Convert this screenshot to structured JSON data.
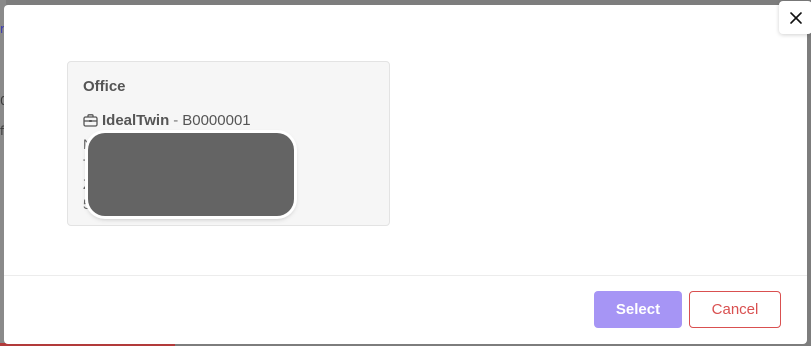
{
  "backdrop": {
    "peek_chars": [
      "r",
      "0",
      "f"
    ]
  },
  "modal": {
    "close_icon": "close-icon",
    "card": {
      "title": "Office",
      "company_icon": "briefcase-icon",
      "company_name": "IdealTwin",
      "separator": "-",
      "company_code": "B0000001",
      "address_line_initials": [
        "N",
        "T",
        "Z",
        "5"
      ]
    },
    "footer": {
      "select_label": "Select",
      "cancel_label": "Cancel"
    },
    "colors": {
      "select_button": "#a695f5",
      "cancel_button": "#d95050",
      "card_background": "#f6f6f6",
      "redaction": "#646464"
    }
  }
}
